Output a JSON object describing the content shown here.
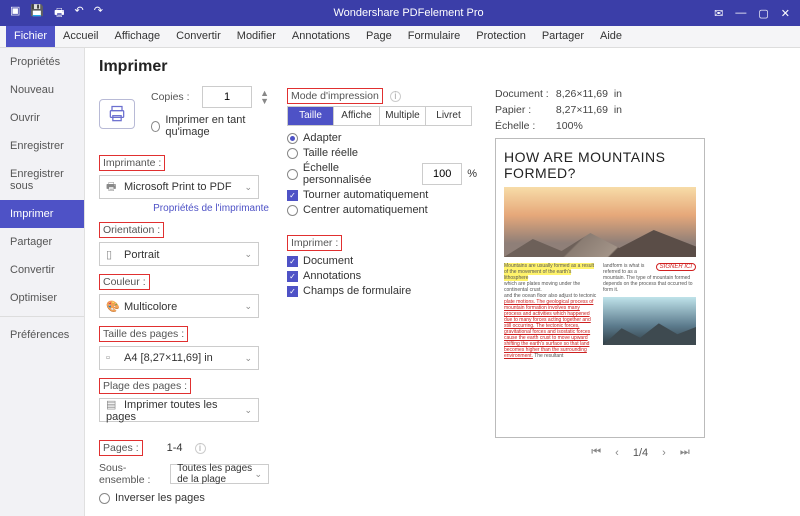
{
  "app": {
    "title": "Wondershare PDFelement Pro"
  },
  "menu": [
    "Fichier",
    "Accueil",
    "Affichage",
    "Convertir",
    "Modifier",
    "Annotations",
    "Page",
    "Formulaire",
    "Protection",
    "Partager",
    "Aide"
  ],
  "menu_active": 0,
  "sidebar": {
    "items": [
      "Propriétés",
      "Nouveau",
      "Ouvrir",
      "Enregistrer",
      "Enregistrer sous",
      "Imprimer",
      "Partager",
      "Convertir",
      "Optimiser"
    ],
    "prefs": "Préférences",
    "active": 5
  },
  "page": {
    "title": "Imprimer",
    "copies_label": "Copies :",
    "copies_value": "1",
    "print_as_image": "Imprimer en tant qu'image",
    "printer_label": "Imprimante :",
    "printer_value": "Microsoft Print to PDF",
    "printer_props": "Propriétés de l'imprimante",
    "orientation_label": "Orientation :",
    "orientation_value": "Portrait",
    "color_label": "Couleur :",
    "color_value": "Multicolore",
    "pagesize_label": "Taille des pages :",
    "pagesize_value": "A4 [8,27×11,69] in",
    "pagerange_label": "Plage des pages :",
    "pagerange_value": "Imprimer toutes les pages",
    "pages_label": "Pages :",
    "pages_value": "1-4",
    "subset_label": "Sous-ensemble :",
    "subset_value": "Toutes les pages de la plage",
    "reverse": "Inverser les pages"
  },
  "mode": {
    "label": "Mode d'impression",
    "tabs": [
      "Taille",
      "Affiche",
      "Multiple",
      "Livret"
    ],
    "active": 0,
    "fit": "Adapter",
    "actual": "Taille réelle",
    "custom": "Échelle personnalisée",
    "custom_value": "100",
    "pct": "%",
    "auto_rotate": "Tourner automatiquement",
    "auto_center": "Centrer automatiquement",
    "print_section": "Imprimer :",
    "print_doc": "Document",
    "print_ann": "Annotations",
    "print_form": "Champs de formulaire"
  },
  "info": {
    "doc_k": "Document :",
    "doc_v": "8,26×11,69",
    "unit": "in",
    "paper_k": "Papier :",
    "paper_v": "8,27×11,69",
    "scale_k": "Échelle :",
    "scale_v": "100%"
  },
  "preview": {
    "headline": "HOW ARE MOUNTAINS FORMED?",
    "stamp": "SIGNER ICI",
    "pager": "1/4"
  }
}
